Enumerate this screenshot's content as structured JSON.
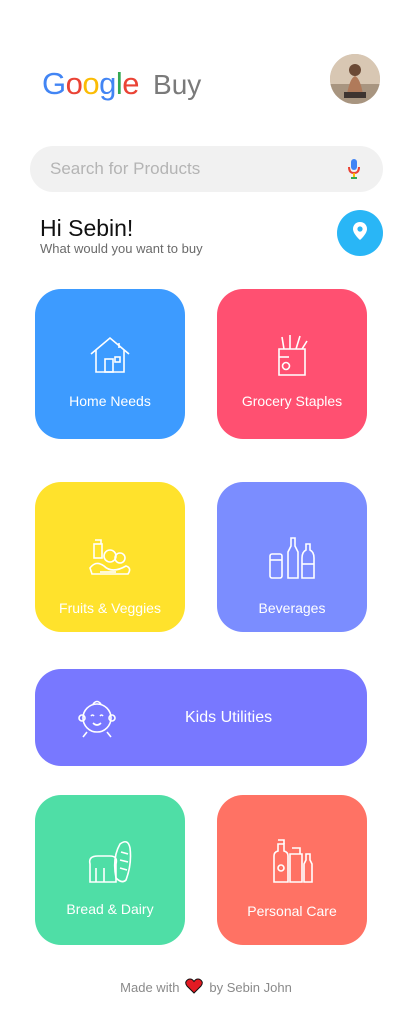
{
  "header": {
    "logo_text": "Google",
    "logo_suffix": "Buy",
    "brand_colors": [
      "#4285F4",
      "#EA4335",
      "#FBBC05",
      "#4285F4",
      "#34A853",
      "#EA4335"
    ]
  },
  "search": {
    "placeholder": "Search for Products",
    "value": ""
  },
  "greeting": {
    "title": "Hi Sebin!",
    "subtitle": "What would you want to buy"
  },
  "categories": [
    {
      "label": "Home Needs",
      "color": "#3d9bff",
      "icon": "house-icon"
    },
    {
      "label": "Grocery Staples",
      "color": "#ff5071",
      "icon": "grocery-bag-icon"
    },
    {
      "label": "Fruits & Veggies",
      "color": "#ffe22c",
      "icon": "fruits-veggies-icon"
    },
    {
      "label": "Beverages",
      "color": "#7b8dff",
      "icon": "bottles-icon"
    },
    {
      "label": "Kids Utilities",
      "color": "#7878ff",
      "icon": "baby-face-icon"
    },
    {
      "label": "Bread & Dairy",
      "color": "#4fdea6",
      "icon": "bread-icon"
    },
    {
      "label": "Personal Care",
      "color": "#ff7264",
      "icon": "cosmetics-icon"
    }
  ],
  "footer": {
    "prefix": "Made with",
    "suffix": "by Sebin John",
    "heart_color": "#e31b23"
  }
}
